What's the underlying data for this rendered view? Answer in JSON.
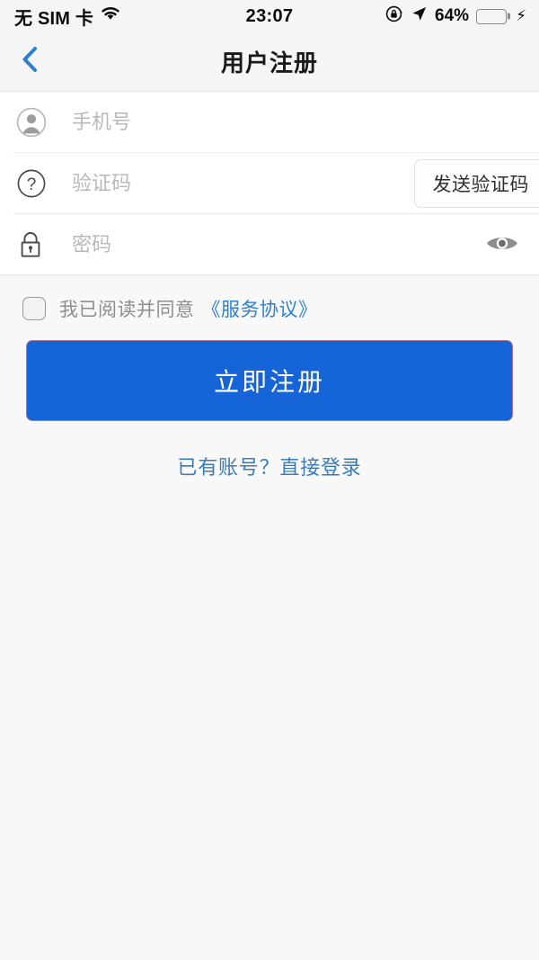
{
  "status_bar": {
    "carrier": "无 SIM 卡",
    "wifi_icon": "wifi-icon",
    "time": "23:07",
    "rotation_lock_icon": "rotation-lock-icon",
    "location_icon": "location-arrow-icon",
    "battery_percent": "64%",
    "battery_level": 64,
    "charging_icon": "lightning-bolt-icon"
  },
  "nav": {
    "back_icon": "chevron-left-icon",
    "title": "用户注册"
  },
  "form": {
    "fields": [
      {
        "name": "phone",
        "icon": "person-icon",
        "placeholder": "手机号",
        "value": ""
      },
      {
        "name": "verify-code",
        "icon": "question-mark-icon",
        "placeholder": "验证码",
        "value": "",
        "action_label": "发送验证码"
      },
      {
        "name": "password",
        "icon": "lock-icon",
        "placeholder": "密码",
        "value": "",
        "toggle_icon": "eye-icon"
      }
    ]
  },
  "agreement": {
    "checked": false,
    "text": "我已阅读并同意",
    "link": "《服务协议》"
  },
  "actions": {
    "register_label": "立即注册",
    "login_link": "已有账号？直接登录"
  },
  "colors": {
    "primary_blue": "#1565d8",
    "button_border": "#b0738d",
    "link_blue": "#2f7fd0",
    "login_blue": "#3b7cb8",
    "nav_back_blue": "#2f7fd0",
    "battery_green": "#4cd263",
    "placeholder_gray": "#b9b9bb",
    "page_background": "#f8f8f9"
  }
}
